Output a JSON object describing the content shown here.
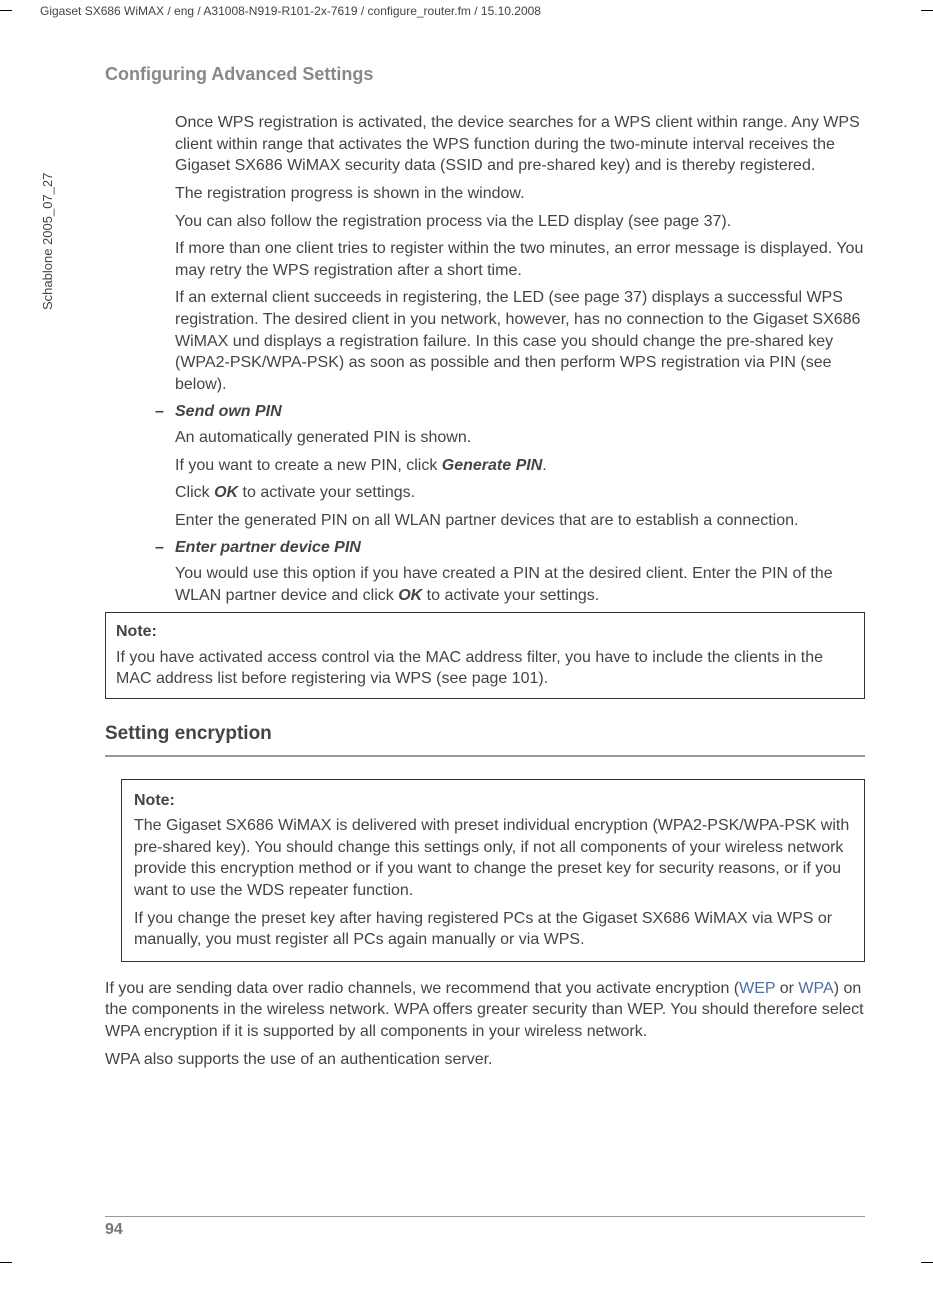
{
  "headerPath": "Gigaset SX686 WiMAX / eng / A31008-N919-R101-2x-7619 / configure_router.fm / 15.10.2008",
  "sidebarText": "Schablone 2005_07_27",
  "sectionTitle": "Configuring Advanced Settings",
  "para1": "Once WPS registration is activated, the device searches for a WPS client within range. Any WPS client within range that activates the WPS function during the two-minute interval receives the Gigaset SX686 WiMAX security data (SSID and pre-shared key) and is thereby registered.",
  "para2": "The registration progress is shown in the window.",
  "para3": "You can also follow the registration process via the LED display (see page 37).",
  "para4": "If more than one client tries to register within the two minutes, an error message is displayed. You may retry the WPS registration after a short time.",
  "para5": "If an external client succeeds in registering, the LED (see page 37) displays a successful WPS registration. The desired client in you network, however, has no connection to the Gigaset SX686 WiMAX und displays a registration failure. In this case you should change the pre-shared key (WPA2-PSK/WPA-PSK) as soon as possible and then perform WPS registration via PIN (see below).",
  "sendOwnPin": "Send own PIN",
  "para6": "An automatically generated PIN is shown.",
  "para7a": "If you want to create a new PIN, click ",
  "para7b": "Generate PIN",
  "para7c": ".",
  "para8a": "Click ",
  "para8b": "OK",
  "para8c": " to activate your settings.",
  "para9": "Enter the generated PIN on all WLAN partner devices that are to establish a connection.",
  "enterPartnerPin": "Enter partner device PIN",
  "para10a": "You would use this option if you have created a PIN at the desired client. Enter the PIN of the WLAN partner device and click ",
  "para10b": "OK",
  "para10c": " to activate your settings.",
  "note1Title": "Note:",
  "note1Body": "If you have activated access control via the MAC address filter, you have to include the clients in the MAC address list before registering via WPS (see page 101).",
  "h2": "Setting encryption",
  "note2Title": "Note:",
  "note2Body1": "The Gigaset SX686 WiMAX is delivered with preset individual encryption (WPA2-PSK/WPA-PSK with pre-shared key). You should change this settings only, if not all components of your wireless network provide this encryption method or if you want to change the preset key for security reasons, or if you want to use the WDS repeater function.",
  "note2Body2": "If you change the preset key after having registered PCs at the Gigaset SX686 WiMAX via WPS or manually, you must register all PCs again manually or via WPS.",
  "para11a": "If you are sending data over radio channels, we recommend that you activate encryption (",
  "para11b": "WEP",
  "para11c": " or ",
  "para11d": "WPA",
  "para11e": ") on the components in the wireless network. WPA offers greater security than WEP. You should therefore select WPA encryption if it is supported by all components in your wireless network.",
  "para12": "WPA also supports the use of an authentication server.",
  "pageNum": "94",
  "dash": "–"
}
